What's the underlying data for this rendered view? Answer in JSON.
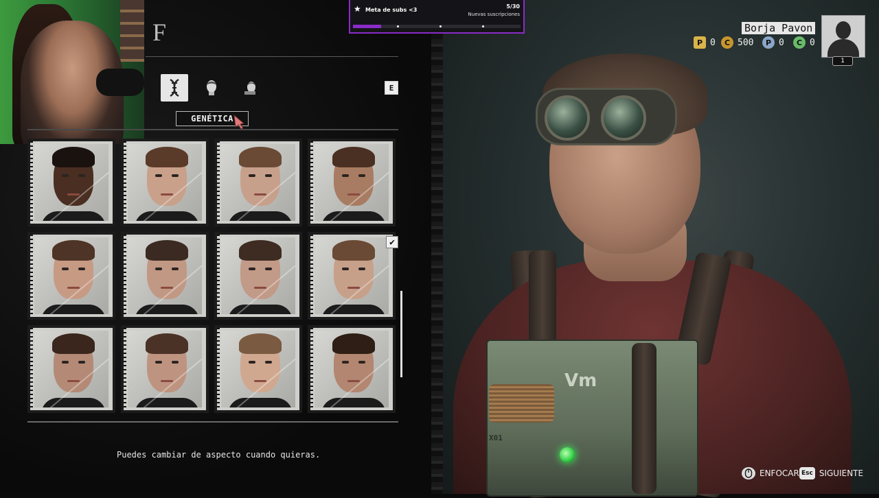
{
  "header": {
    "title": "F"
  },
  "tabs": [
    {
      "name": "genetics-tab",
      "icon": "dna-icon",
      "active": true
    },
    {
      "name": "head-tab",
      "icon": "head-icon",
      "active": false
    },
    {
      "name": "face-tab",
      "icon": "face-icon",
      "active": false
    }
  ],
  "key_hint": "E",
  "section_label": "GENÉTICA",
  "faces": [
    {
      "skin": "#4a2e22",
      "hair": "#1a120e",
      "selected": false
    },
    {
      "skin": "#c9a08a",
      "hair": "#5a3a28",
      "selected": false
    },
    {
      "skin": "#c7a08c",
      "hair": "#6a4a34",
      "selected": false
    },
    {
      "skin": "#a87c62",
      "hair": "#4a3022",
      "selected": false
    },
    {
      "skin": "#c79a84",
      "hair": "#4e3426",
      "selected": false
    },
    {
      "skin": "#c19884",
      "hair": "#3a2a22",
      "selected": false
    },
    {
      "skin": "#c29a88",
      "hair": "#3e2c22",
      "selected": false
    },
    {
      "skin": "#c7a08a",
      "hair": "#6a4a34",
      "selected": true
    },
    {
      "skin": "#b48a76",
      "hair": "#3a261c",
      "selected": false
    },
    {
      "skin": "#be9480",
      "hair": "#4a3226",
      "selected": false
    },
    {
      "skin": "#d0a890",
      "hair": "#7a5a40",
      "selected": false
    },
    {
      "skin": "#b28670",
      "hair": "#2e1e16",
      "selected": false
    }
  ],
  "hint_text": "Puedes cambiar de aspecto cuando quieras.",
  "subgoal": {
    "title": "Meta de subs <3",
    "count": "5/30",
    "subtitle": "Nuevas suscripciones",
    "progress": 0.1667,
    "star_icon": "star-icon"
  },
  "player": {
    "name": "Borja Pavon",
    "level": "1",
    "currencies": [
      {
        "icon": "P",
        "color": "#d9b44a",
        "value": "0"
      },
      {
        "icon": "C",
        "color": "#c8962e",
        "value": "500"
      },
      {
        "icon": "P",
        "color": "#8aa6c8",
        "value": "0"
      },
      {
        "icon": "C",
        "color": "#6aba6a",
        "value": "0"
      }
    ]
  },
  "prompts": {
    "focus_label": "ENFOCAR",
    "focus_key": "mouse",
    "next_key": "Esc",
    "next_label": "SIGUIENTE"
  },
  "device": {
    "label": "X01",
    "logo": "Vm"
  }
}
